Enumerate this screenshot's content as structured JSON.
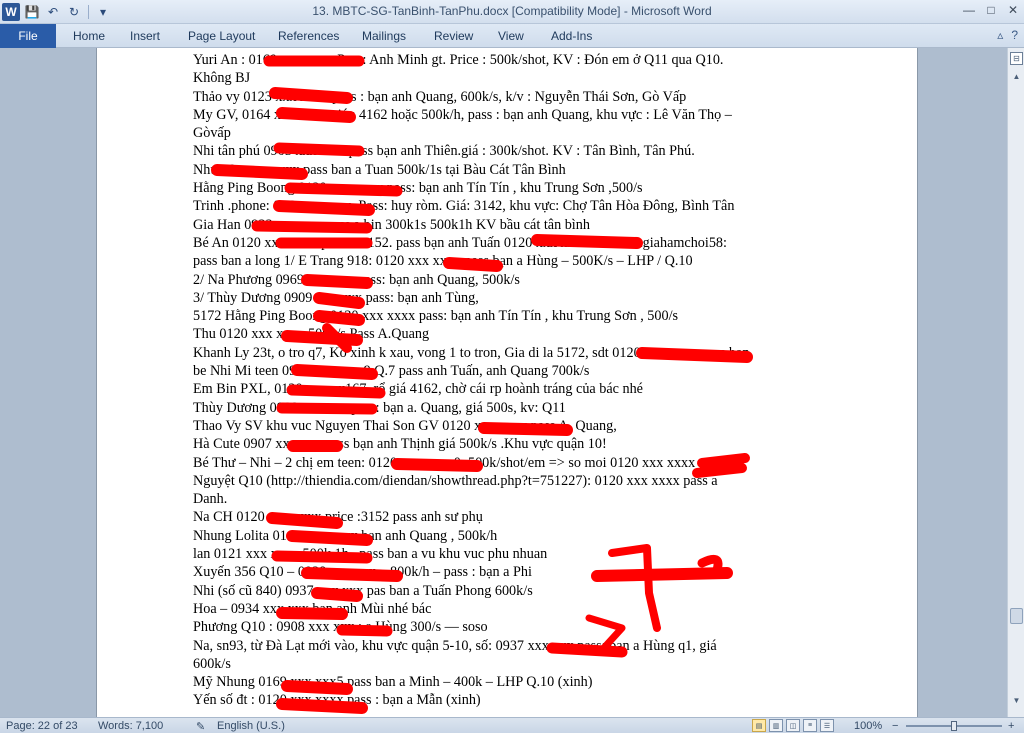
{
  "window": {
    "title": "13. MBTC-SG-TanBinh-TanPhu.docx [Compatibility Mode] - Microsoft Word",
    "app_icon_letter": "W",
    "controls": [
      "—",
      "□",
      "✕"
    ]
  },
  "quick_access": {
    "save": "💾",
    "undo": "↶",
    "redo": "↻",
    "customize": "▾"
  },
  "ribbon": {
    "file_label": "File",
    "tabs": [
      "Home",
      "Insert",
      "Page Layout",
      "References",
      "Mailings",
      "Review",
      "View",
      "Add-Ins"
    ],
    "right": {
      "minimize": "▵",
      "help": "?"
    }
  },
  "document": {
    "lines": [
      "Yuri An : 0169 xxx xxxx Pass: Anh Minh gt. Price : 500k/shot, KV : Đón em ở Q11 qua Q10.",
      "Không BJ",
      "Thảo vy 0123 xxx xxxx pass : bạn anh Quang, 600k/s, k/v : Nguyễn Thái Sơn, Gò Vấp",
      "My GV, 0164 xxx xxxx giá : 4162 hoặc 500k/h, pass : bạn anh Quang, khu vực : Lê Văn Thọ –",
      "Gòvấp",
      "Nhi tân phú 0903 xxx xxx. pass bạn anh Thiên.giá : 300k/shot. KV : Tân Bình, Tân Phú.",
      "Như 09xx xxx xxx pass ban a Tuan 500k/1s tại Bàu Cát Tân Bình",
      "Hằng Ping Boong 0120 xxx xxxx pass: bạn anh Tín Tín , khu Trung Sơn ,500/s",
      "Trinh .phone: 016 xxx xxxx. Pass: huy ròm. Giá: 3142, khu vực: Chợ Tân Hòa Đông, Bình Tân",
      "Gia Han 0933 xxx xxx pass a bin 300k1s 500k1h KV bầu cát tân bình",
      "Bé An 0120 xxx xxxx price : 3152. pass bạn anh Tuấn 0120 xxx xxxx nhi thieugiahamchoi58:",
      "pass ban a long 1/ E Trang 918: 0120 xxx xxxx pass bạn a Hùng – 500K/s – LHP / Q.10",
      "2/ Na Phương 0969 xxx xxx pass: bạn anh Quang, 500k/s",
      "3/ Thùy Dương 0909 xxx xxx pass: bạn anh Tùng,",
      "5172 Hằng Ping Boong 0120 xxx xxxx pass: bạn anh Tín Tín , khu Trung Sơn , 500/s",
      "Thu 0120 xxx xxxx 500k/s Pass A.Quang",
      "Khanh Ly 23t, o tro q7, Ko xinh k xau, vong 1 to tron, Gia di la 5172, sdt 0120 xxx xxxx pass ban",
      "be Nhi Mi teen 0937 xxx xxx 9 Q.7 pass anh Tuấn, anh Quang 700k/s",
      "Em Bin PXL, 0120 xxx xx167, rổ giá 4162, chờ cái rp hoành tráng của bác nhé",
      "Thùy Dương 0909 xxx xxx pass: bạn a. Quang, giá 500s, kv: Q11",
      "Thao Vy SV khu vuc Nguyen Thai Son GV 0120 xxx xxxx pass A. Quang,",
      "Hà Cute 0907 xxx xxx pass bạn anh Thịnh giá 500k/s .Khu vực quận 10!",
      "Bé Thư – Nhi – 2 chị em teen: 0120 xxx xxxx0. 500k/shot/em => so moi 0120 xxx xxxx ═══",
      "Nguyệt Q10 (http://thiendia.com/diendan/showthread.php?t=751227): 0120 xxx xxxx pass a",
      "Danh.",
      "Na CH 0120 xxx xxxx price :3152 pass anh sư phụ",
      "Nhung Lolita 0169 xxx xxxx bạn anh Quang , 500k/h",
      "lan 0121 xxx xxxx 500k 1h , pass ban a vu khu vuc phu nhuan",
      "Xuyến 356 Q10 – 0938 xxx xxx – 800k/h – pass : bạn a Phi",
      "Nhi (số cũ 840) 0937 xxx xxx pas ban a Tuấn Phong 600k/s",
      "Hoa – 0934 xxx xxx bạn anh Mùi nhé bác",
      "Phương Q10 : 0908 xxx xxx : a.Hùng 300/s — soso",
      "Na, sn93, từ Đà Lạt mới vào, khu vực quận 5-10, số: 0937 xxx xxx pass: bạn a Hùng q1, giá",
      "600k/s",
      "Mỹ Nhung 0169 xxx xxx5 pass ban a Minh – 400k – LHP Q.10 (xinh)",
      "Yến số đt : 0120 xxx xxxx pass : bạn a Mẫn (xinh)"
    ]
  },
  "scroll": {
    "up": "▲",
    "down": "▼",
    "ruler": "⊟"
  },
  "status": {
    "page": "Page: 22 of 23",
    "words": "Words: 7,100",
    "language": "English (U.S.)",
    "zoom": "100%",
    "zoom_minus": "−",
    "zoom_plus": "+"
  }
}
